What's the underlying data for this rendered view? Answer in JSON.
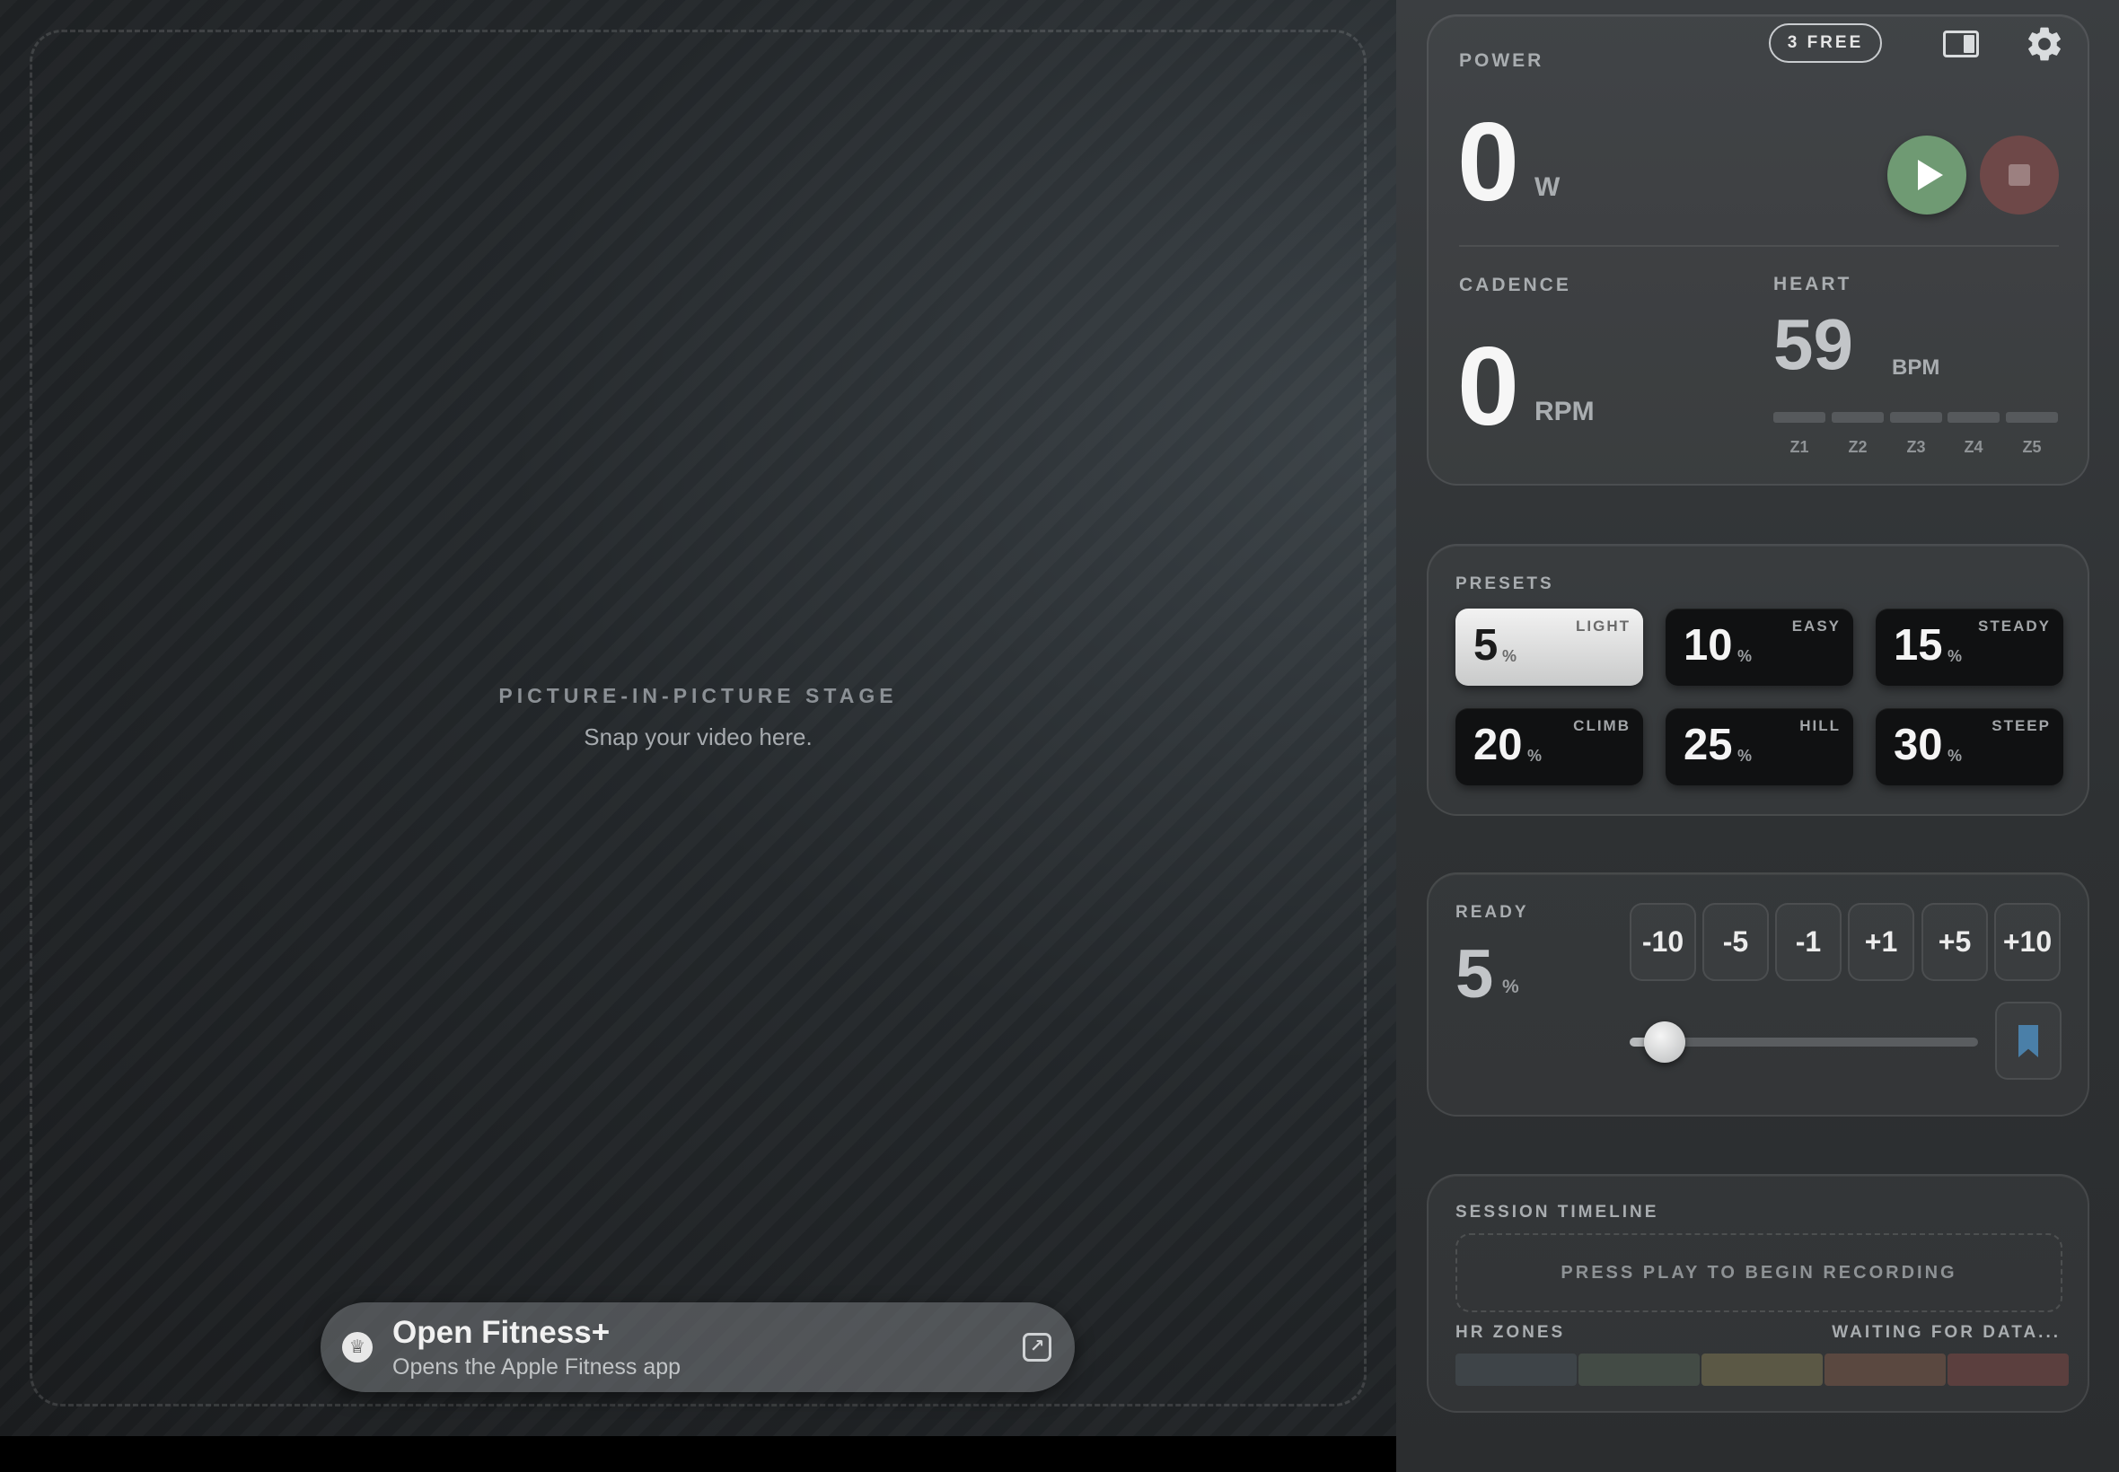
{
  "stage": {
    "title": "PICTURE-IN-PICTURE STAGE",
    "subtitle": "Snap your video here.",
    "pill": {
      "title": "Open Fitness+",
      "subtitle": "Opens the Apple Fitness app",
      "icon": "fitness-icon",
      "action_icon": "external-link-icon"
    }
  },
  "header": {
    "free_badge": "3 FREE",
    "layout_icon": "split-layout-icon",
    "settings_icon": "gear-icon"
  },
  "metrics": {
    "power_label": "POWER",
    "power_value": "0",
    "power_unit": "W",
    "cadence_label": "CADENCE",
    "cadence_value": "0",
    "cadence_unit": "RPM",
    "heart_label": "HEART",
    "heart_value": "59",
    "heart_unit": "BPM",
    "zones": [
      "Z1",
      "Z2",
      "Z3",
      "Z4",
      "Z5"
    ]
  },
  "presets": {
    "label": "PRESETS",
    "items": [
      {
        "value": "5",
        "unit": "%",
        "name": "LIGHT",
        "active": true
      },
      {
        "value": "10",
        "unit": "%",
        "name": "EASY",
        "active": false
      },
      {
        "value": "15",
        "unit": "%",
        "name": "STEADY",
        "active": false
      },
      {
        "value": "20",
        "unit": "%",
        "name": "CLIMB",
        "active": false
      },
      {
        "value": "25",
        "unit": "%",
        "name": "HILL",
        "active": false
      },
      {
        "value": "30",
        "unit": "%",
        "name": "STEEP",
        "active": false
      }
    ]
  },
  "ready": {
    "label": "READY",
    "value": "5",
    "unit": "%",
    "steps": [
      "-10",
      "-5",
      "-1",
      "+1",
      "+5",
      "+10"
    ],
    "slider_percent": 5,
    "bookmark_icon": "bookmark-icon"
  },
  "session": {
    "label": "SESSION TIMELINE",
    "placeholder": "PRESS PLAY TO BEGIN RECORDING",
    "hr_label": "HR ZONES",
    "hr_status": "WAITING FOR DATA...",
    "zone_colors": [
      "#3e4448",
      "#434b45",
      "#5b5845",
      "#5a4840",
      "#5b3f3e"
    ]
  },
  "colors": {
    "play": "#6f9a73",
    "stop": "#6e4848",
    "accent_bookmark": "#4a7fa8"
  }
}
